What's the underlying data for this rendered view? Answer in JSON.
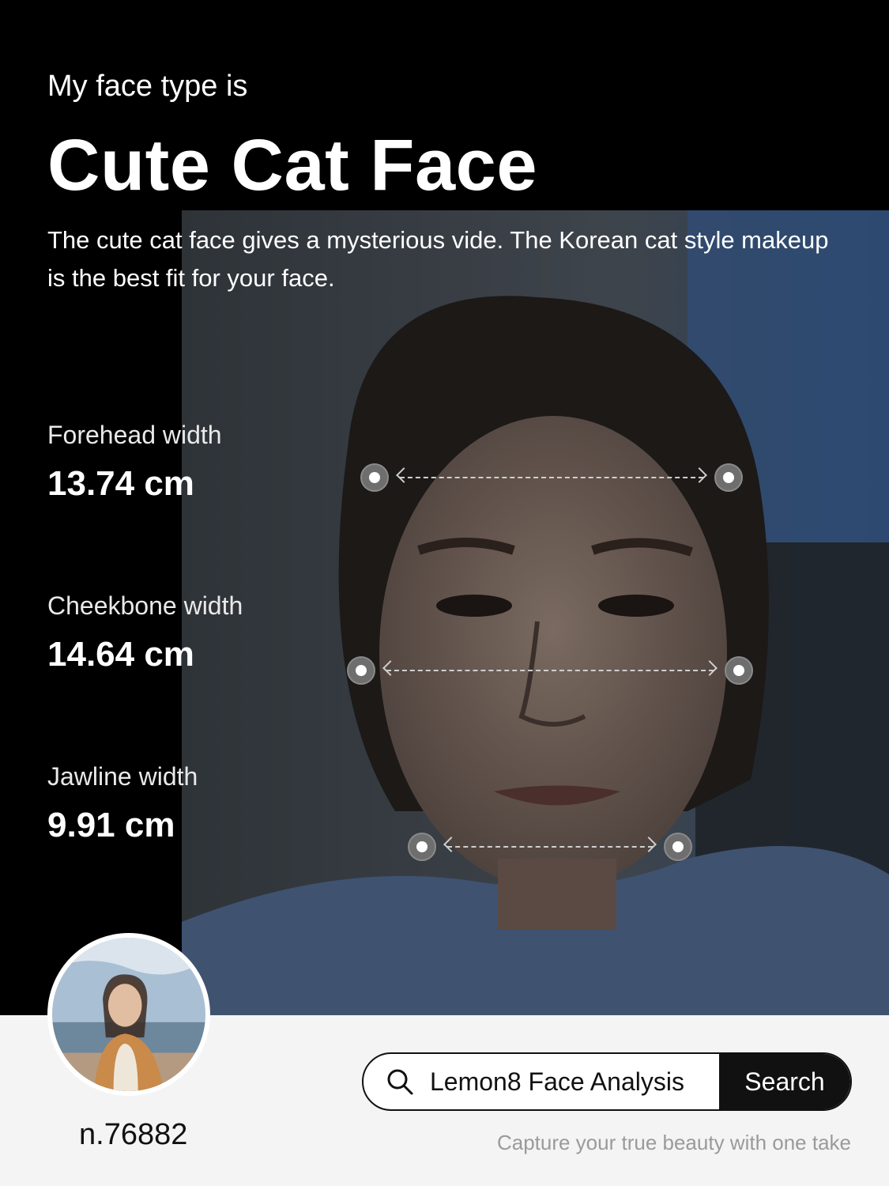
{
  "header": {
    "subtitle": "My face type is",
    "title": "Cute Cat Face",
    "description": "The cute cat face gives a mysterious vide. The Korean cat style makeup is the best fit for your face."
  },
  "metrics": [
    {
      "label": "Forehead width",
      "value": "13.74 cm"
    },
    {
      "label": "Cheekbone width",
      "value": "14.64 cm"
    },
    {
      "label": "Jawline width",
      "value": "9.91 cm"
    }
  ],
  "profile": {
    "username": "n.76882"
  },
  "search": {
    "query": "Lemon8 Face Analysis",
    "button_label": "Search",
    "tagline": "Capture your true beauty with one take"
  },
  "colors": {
    "background": "#000000",
    "bottom_bar": "#f4f4f4",
    "search_button": "#111111"
  },
  "icons": {
    "search": "search-icon",
    "measure_dot": "measure-dot-icon"
  }
}
